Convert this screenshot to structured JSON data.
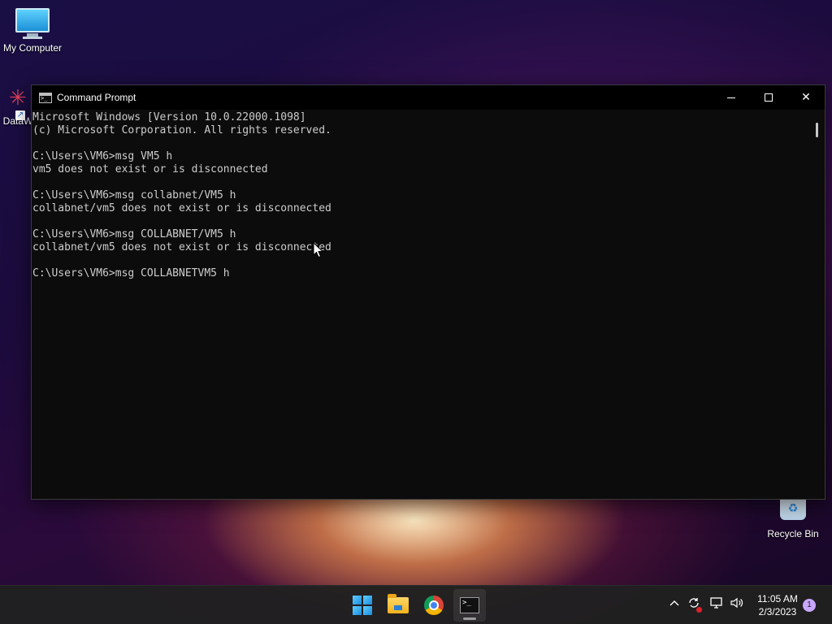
{
  "desktop": {
    "icons": [
      {
        "label": "My Computer"
      },
      {
        "label": "DataW"
      },
      {
        "label": "Recycle Bin"
      }
    ]
  },
  "window": {
    "title": "Command Prompt",
    "console_lines": [
      "Microsoft Windows [Version 10.0.22000.1098]",
      "(c) Microsoft Corporation. All rights reserved.",
      "",
      "C:\\Users\\VM6>msg VM5 h",
      "vm5 does not exist or is disconnected",
      "",
      "C:\\Users\\VM6>msg collabnet/VM5 h",
      "collabnet/vm5 does not exist or is disconnected",
      "",
      "C:\\Users\\VM6>msg COLLABNET/VM5 h",
      "collabnet/vm5 does not exist or is disconnected",
      "",
      "C:\\Users\\VM6>msg COLLABNETVM5 h"
    ]
  },
  "taskbar": {
    "apps": [
      "start-icon",
      "file-explorer-icon",
      "chrome-icon",
      "command-prompt-icon"
    ],
    "tray": {
      "icons": [
        "chevron-up-icon",
        "sync-icon",
        "network-icon",
        "volume-icon"
      ],
      "time": "11:05 AM",
      "date": "2/3/2023",
      "notification_count": "1"
    }
  },
  "colors": {
    "console_bg": "#0c0c0c",
    "console_text": "#cccccc",
    "taskbar_bg": "#202020"
  }
}
